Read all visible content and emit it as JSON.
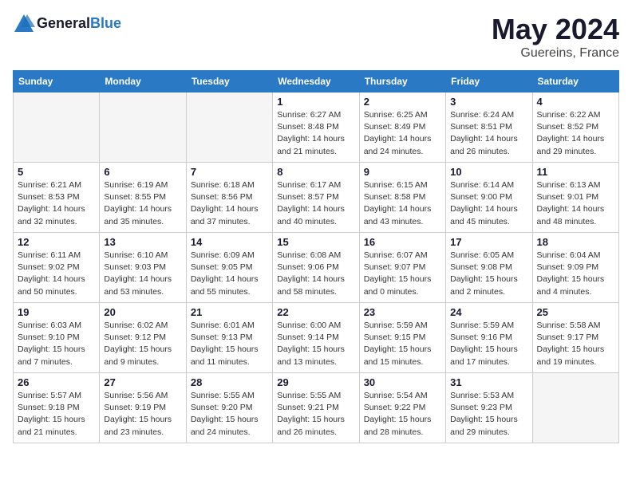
{
  "header": {
    "logo_general": "General",
    "logo_blue": "Blue",
    "month_year": "May 2024",
    "location": "Guereins, France"
  },
  "weekdays": [
    "Sunday",
    "Monday",
    "Tuesday",
    "Wednesday",
    "Thursday",
    "Friday",
    "Saturday"
  ],
  "weeks": [
    [
      {
        "num": "",
        "info": "",
        "empty": true
      },
      {
        "num": "",
        "info": "",
        "empty": true
      },
      {
        "num": "",
        "info": "",
        "empty": true
      },
      {
        "num": "1",
        "info": "Sunrise: 6:27 AM\nSunset: 8:48 PM\nDaylight: 14 hours\nand 21 minutes."
      },
      {
        "num": "2",
        "info": "Sunrise: 6:25 AM\nSunset: 8:49 PM\nDaylight: 14 hours\nand 24 minutes."
      },
      {
        "num": "3",
        "info": "Sunrise: 6:24 AM\nSunset: 8:51 PM\nDaylight: 14 hours\nand 26 minutes."
      },
      {
        "num": "4",
        "info": "Sunrise: 6:22 AM\nSunset: 8:52 PM\nDaylight: 14 hours\nand 29 minutes."
      }
    ],
    [
      {
        "num": "5",
        "info": "Sunrise: 6:21 AM\nSunset: 8:53 PM\nDaylight: 14 hours\nand 32 minutes."
      },
      {
        "num": "6",
        "info": "Sunrise: 6:19 AM\nSunset: 8:55 PM\nDaylight: 14 hours\nand 35 minutes."
      },
      {
        "num": "7",
        "info": "Sunrise: 6:18 AM\nSunset: 8:56 PM\nDaylight: 14 hours\nand 37 minutes."
      },
      {
        "num": "8",
        "info": "Sunrise: 6:17 AM\nSunset: 8:57 PM\nDaylight: 14 hours\nand 40 minutes."
      },
      {
        "num": "9",
        "info": "Sunrise: 6:15 AM\nSunset: 8:58 PM\nDaylight: 14 hours\nand 43 minutes."
      },
      {
        "num": "10",
        "info": "Sunrise: 6:14 AM\nSunset: 9:00 PM\nDaylight: 14 hours\nand 45 minutes."
      },
      {
        "num": "11",
        "info": "Sunrise: 6:13 AM\nSunset: 9:01 PM\nDaylight: 14 hours\nand 48 minutes."
      }
    ],
    [
      {
        "num": "12",
        "info": "Sunrise: 6:11 AM\nSunset: 9:02 PM\nDaylight: 14 hours\nand 50 minutes."
      },
      {
        "num": "13",
        "info": "Sunrise: 6:10 AM\nSunset: 9:03 PM\nDaylight: 14 hours\nand 53 minutes."
      },
      {
        "num": "14",
        "info": "Sunrise: 6:09 AM\nSunset: 9:05 PM\nDaylight: 14 hours\nand 55 minutes."
      },
      {
        "num": "15",
        "info": "Sunrise: 6:08 AM\nSunset: 9:06 PM\nDaylight: 14 hours\nand 58 minutes."
      },
      {
        "num": "16",
        "info": "Sunrise: 6:07 AM\nSunset: 9:07 PM\nDaylight: 15 hours\nand 0 minutes."
      },
      {
        "num": "17",
        "info": "Sunrise: 6:05 AM\nSunset: 9:08 PM\nDaylight: 15 hours\nand 2 minutes."
      },
      {
        "num": "18",
        "info": "Sunrise: 6:04 AM\nSunset: 9:09 PM\nDaylight: 15 hours\nand 4 minutes."
      }
    ],
    [
      {
        "num": "19",
        "info": "Sunrise: 6:03 AM\nSunset: 9:10 PM\nDaylight: 15 hours\nand 7 minutes."
      },
      {
        "num": "20",
        "info": "Sunrise: 6:02 AM\nSunset: 9:12 PM\nDaylight: 15 hours\nand 9 minutes."
      },
      {
        "num": "21",
        "info": "Sunrise: 6:01 AM\nSunset: 9:13 PM\nDaylight: 15 hours\nand 11 minutes."
      },
      {
        "num": "22",
        "info": "Sunrise: 6:00 AM\nSunset: 9:14 PM\nDaylight: 15 hours\nand 13 minutes."
      },
      {
        "num": "23",
        "info": "Sunrise: 5:59 AM\nSunset: 9:15 PM\nDaylight: 15 hours\nand 15 minutes."
      },
      {
        "num": "24",
        "info": "Sunrise: 5:59 AM\nSunset: 9:16 PM\nDaylight: 15 hours\nand 17 minutes."
      },
      {
        "num": "25",
        "info": "Sunrise: 5:58 AM\nSunset: 9:17 PM\nDaylight: 15 hours\nand 19 minutes."
      }
    ],
    [
      {
        "num": "26",
        "info": "Sunrise: 5:57 AM\nSunset: 9:18 PM\nDaylight: 15 hours\nand 21 minutes."
      },
      {
        "num": "27",
        "info": "Sunrise: 5:56 AM\nSunset: 9:19 PM\nDaylight: 15 hours\nand 23 minutes."
      },
      {
        "num": "28",
        "info": "Sunrise: 5:55 AM\nSunset: 9:20 PM\nDaylight: 15 hours\nand 24 minutes."
      },
      {
        "num": "29",
        "info": "Sunrise: 5:55 AM\nSunset: 9:21 PM\nDaylight: 15 hours\nand 26 minutes."
      },
      {
        "num": "30",
        "info": "Sunrise: 5:54 AM\nSunset: 9:22 PM\nDaylight: 15 hours\nand 28 minutes."
      },
      {
        "num": "31",
        "info": "Sunrise: 5:53 AM\nSunset: 9:23 PM\nDaylight: 15 hours\nand 29 minutes."
      },
      {
        "num": "",
        "info": "",
        "empty": true
      }
    ]
  ]
}
